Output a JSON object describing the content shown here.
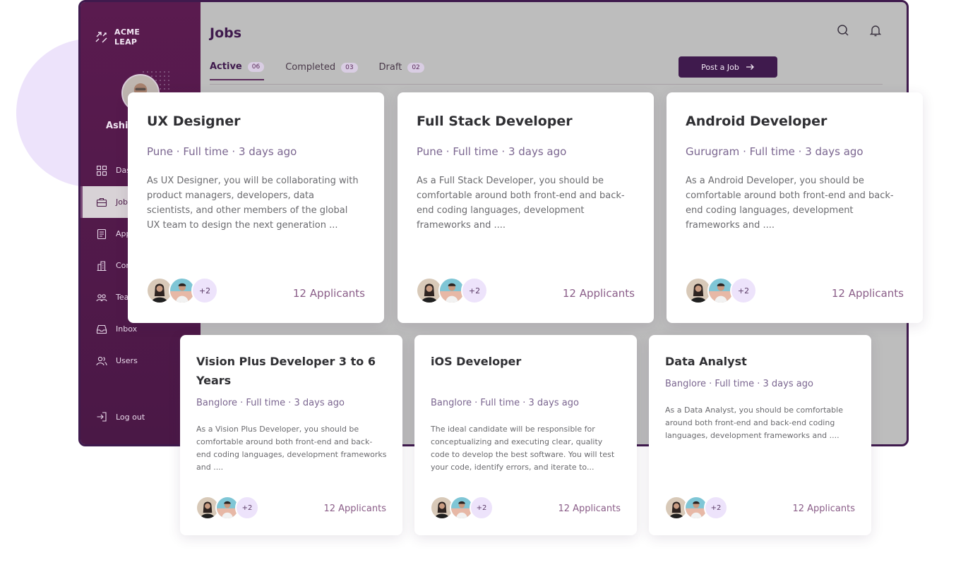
{
  "sidebar": {
    "logo_line1": "ACME",
    "logo_line2": "LEAP",
    "user_name": "Ashis",
    "items": [
      {
        "label": "Das",
        "icon": "dashboard-icon"
      },
      {
        "label": "Job",
        "icon": "briefcase-icon"
      },
      {
        "label": "App",
        "icon": "document-icon"
      },
      {
        "label": "Cor",
        "icon": "building-icon"
      },
      {
        "label": "Tea",
        "icon": "team-icon"
      },
      {
        "label": "Inbox",
        "icon": "inbox-icon"
      },
      {
        "label": "Users",
        "icon": "users-icon"
      }
    ],
    "logout_label": "Log out"
  },
  "header": {
    "title": "Jobs",
    "post_button_label": "Post a Job"
  },
  "tabs": [
    {
      "label": "Active",
      "count": "06"
    },
    {
      "label": "Completed",
      "count": "03"
    },
    {
      "label": "Draft",
      "count": "02"
    }
  ],
  "jobs": [
    {
      "title": "UX Designer",
      "meta": "Pune · Full time · 3 days ago",
      "description": "As UX Designer, you will be collaborating with product managers, developers, data scientists, and other members of the global UX team to design the next generation ...",
      "more": "+2",
      "applicants": "12 Applicants"
    },
    {
      "title": "Full Stack Developer",
      "meta": "Pune · Full time · 3 days ago",
      "description": "As a Full Stack Developer, you should be comfortable around both front-end and back-end coding languages, development frameworks and ....",
      "more": "+2",
      "applicants": "12 Applicants"
    },
    {
      "title": "Android Developer",
      "meta": "Gurugram · Full time · 3 days ago",
      "description": "As a Android Developer, you should be comfortable around both front-end and back-end coding languages, development frameworks and ....",
      "more": "+2",
      "applicants": "12 Applicants"
    },
    {
      "title": "Vision Plus Developer 3 to 6 Years",
      "meta": "Banglore · Full time · 3 days ago",
      "description": "As a Vision Plus Developer, you should be comfortable around both front-end and back-end coding languages, development frameworks and ....",
      "more": "+2",
      "applicants": "12 Applicants"
    },
    {
      "title": "iOS Developer",
      "meta": "Banglore · Full time · 3 days ago",
      "description": "The ideal candidate will be responsible for conceptualizing and executing clear, quality code to develop the best software. You will test your code, identify errors, and iterate to...",
      "more": "+2",
      "applicants": "12 Applicants"
    },
    {
      "title": "Data Analyst",
      "meta": "Banglore · Full time · 3 days ago",
      "description": "As a Data Analyst, you should be comfortable around both front-end and back-end coding languages, development frameworks and ....",
      "more": "+2",
      "applicants": "12 Applicants"
    }
  ],
  "colors": {
    "brand": "#4a1846",
    "accent": "#3f1a4d",
    "meta": "#7b6690",
    "applicants": "#8a5d88",
    "badge_bg": "#ede3fb"
  }
}
